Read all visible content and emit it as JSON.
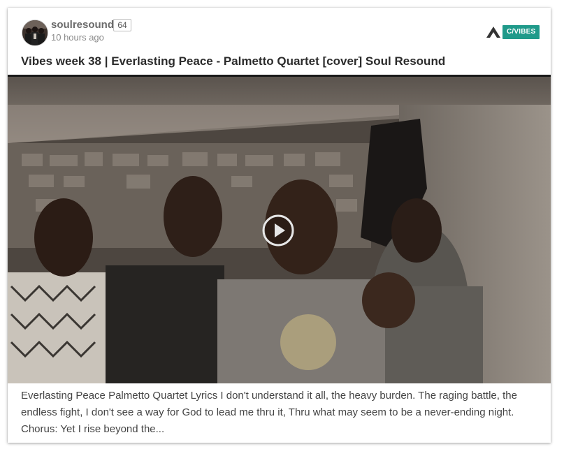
{
  "post": {
    "author": {
      "username": "soulresound",
      "reputation": "64",
      "avatar_icon": "group-photo-avatar"
    },
    "timestamp": "10 hours ago",
    "community": {
      "logo_icon": "mountain-logo-icon",
      "tag": "C/VIBES",
      "tag_color": "#1f9a8a"
    },
    "title": "Vibes week 38 | Everlasting Peace - Palmetto Quartet [cover] Soul Resound",
    "video": {
      "play_icon": "play-circle-icon"
    },
    "description": "Everlasting Peace Palmetto Quartet Lyrics I don't understand it all, the heavy burden. The raging battle, the endless fight, I don't see a way for God to lead me thru it, Thru what may seem to be a never-ending night. Chorus: Yet I rise beyond the..."
  }
}
